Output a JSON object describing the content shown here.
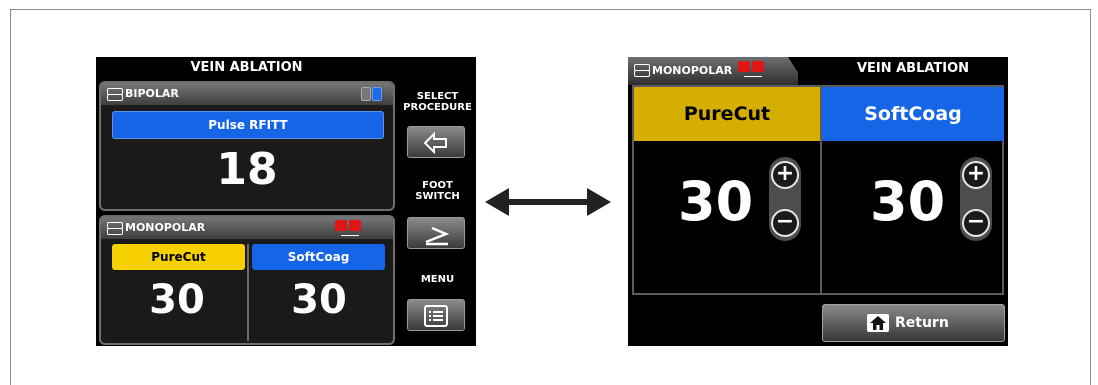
{
  "left_screen": {
    "title": "VEIN ABLATION",
    "bipolar": {
      "label": "BIPOLAR",
      "procedure": "Pulse RFITT",
      "value": "18"
    },
    "monopolar": {
      "label": "MONOPOLAR",
      "mode1": {
        "label": "PureCut",
        "value": "30",
        "color": "#f7d000"
      },
      "mode2": {
        "label": "SoftCoag",
        "value": "30",
        "color": "#1665e6"
      }
    },
    "side": {
      "select_procedure": "SELECT PROCEDURE",
      "foot_switch": "FOOT SWITCH",
      "menu": "MENU"
    }
  },
  "right_screen": {
    "tab_label": "MONOPOLAR",
    "title": "VEIN ABLATION",
    "mode1": {
      "label": "PureCut",
      "value": "30",
      "color": "#d4ae00"
    },
    "mode2": {
      "label": "SoftCoag",
      "value": "30",
      "color": "#1665e6"
    },
    "plus": "+",
    "minus": "−",
    "return_label": "Return"
  },
  "icons": [
    "bipolar-mode-icon",
    "monopolar-mode-icon",
    "blue-foot-pedal-icon",
    "red-foot-pedal-icon",
    "select-procedure-arrow-icon",
    "foot-switch-icon",
    "menu-list-icon",
    "home-icon",
    "double-arrow-icon"
  ]
}
